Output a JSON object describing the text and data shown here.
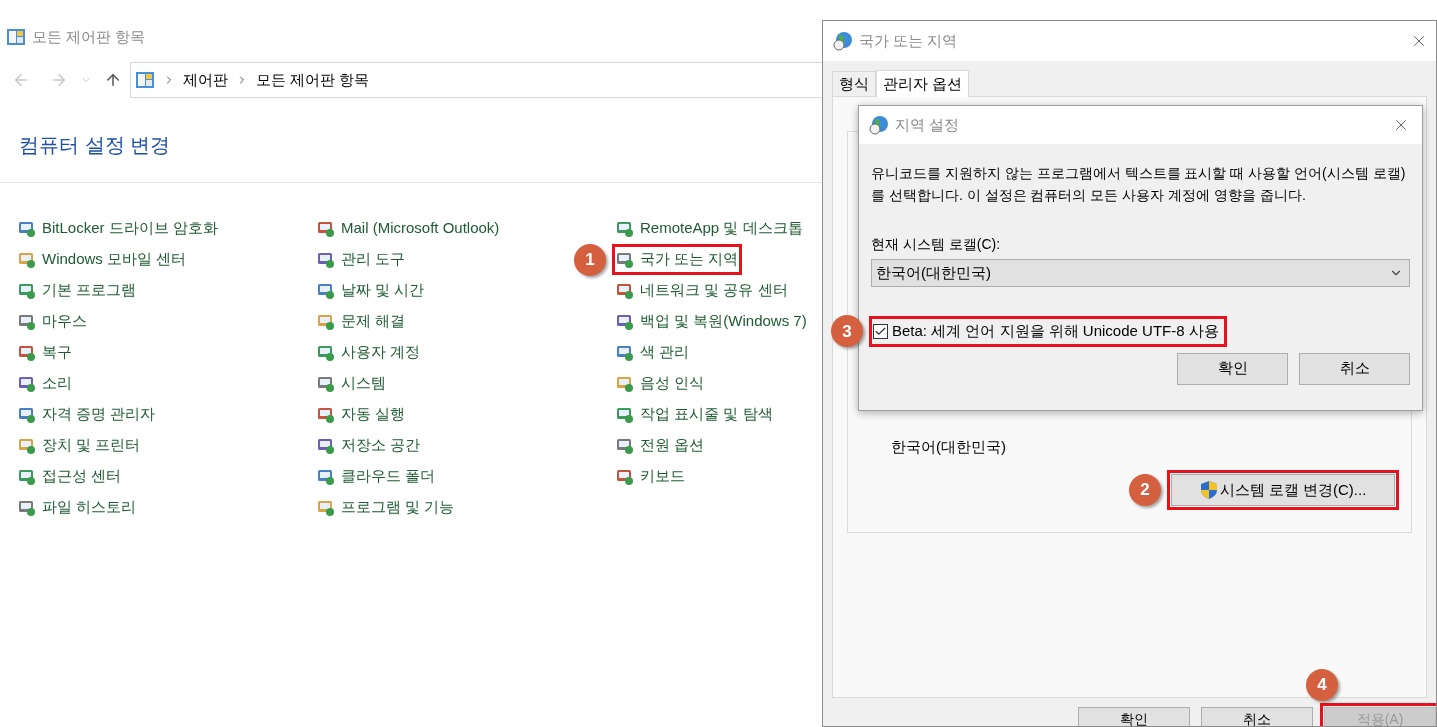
{
  "explorer": {
    "title": "모든 제어판 항목",
    "breadcrumbs": [
      "제어판",
      "모든 제어판 항목"
    ],
    "heading": "컴퓨터 설정 변경",
    "columns": [
      [
        {
          "label": "BitLocker 드라이브 암호화"
        },
        {
          "label": "Windows 모바일 센터"
        },
        {
          "label": "기본 프로그램"
        },
        {
          "label": "마우스"
        },
        {
          "label": "복구"
        },
        {
          "label": "소리"
        },
        {
          "label": "자격 증명 관리자"
        },
        {
          "label": "장치 및 프린터"
        },
        {
          "label": "접근성 센터"
        },
        {
          "label": "파일 히스토리"
        }
      ],
      [
        {
          "label": "Mail (Microsoft Outlook)"
        },
        {
          "label": "관리 도구"
        },
        {
          "label": "날짜 및 시간"
        },
        {
          "label": "문제 해결"
        },
        {
          "label": "사용자 계정"
        },
        {
          "label": "시스템"
        },
        {
          "label": "자동 실행"
        },
        {
          "label": "저장소 공간"
        },
        {
          "label": "클라우드 폴더"
        },
        {
          "label": "프로그램 및 기능"
        }
      ],
      [
        {
          "label": "RemoteApp 및 데스크톱"
        },
        {
          "label": "국가 또는 지역",
          "callout": "1"
        },
        {
          "label": "네트워크 및 공유 센터"
        },
        {
          "label": "백업 및 복원(Windows 7)"
        },
        {
          "label": "색 관리"
        },
        {
          "label": "음성 인식"
        },
        {
          "label": "작업 표시줄 및 탐색"
        },
        {
          "label": "전원 옵션"
        },
        {
          "label": "키보드"
        }
      ]
    ]
  },
  "region_dialog": {
    "title": "국가 또는 지역",
    "tabs": [
      {
        "label": "형식",
        "selected": false
      },
      {
        "label": "관리자 옵션",
        "selected": true
      }
    ],
    "current_locale": "한국어(대한민국)",
    "change_button": {
      "label": "시스템 로캘 변경(C)...",
      "callout": "2"
    },
    "buttons": [
      {
        "label": "확인",
        "disabled": false
      },
      {
        "label": "취소",
        "disabled": false
      },
      {
        "label": "적용(A)",
        "disabled": true,
        "callout": "4"
      }
    ]
  },
  "locale_dialog": {
    "title": "지역 설정",
    "description": "유니코드를 지원하지 않는 프로그램에서 텍스트를 표시할 때 사용할 언어(시스템 로캘)를 선택합니다. 이 설정은 컴퓨터의 모든 사용자 계정에 영향을 줍니다.",
    "locale_label": "현재 시스템 로캘(C):",
    "locale_value": "한국어(대한민국)",
    "utf8_option": {
      "label": "Beta: 세계 언어 지원을 위해 Unicode UTF-8 사용",
      "checked": true,
      "callout": "3"
    },
    "buttons": [
      {
        "label": "확인"
      },
      {
        "label": "취소"
      }
    ]
  }
}
